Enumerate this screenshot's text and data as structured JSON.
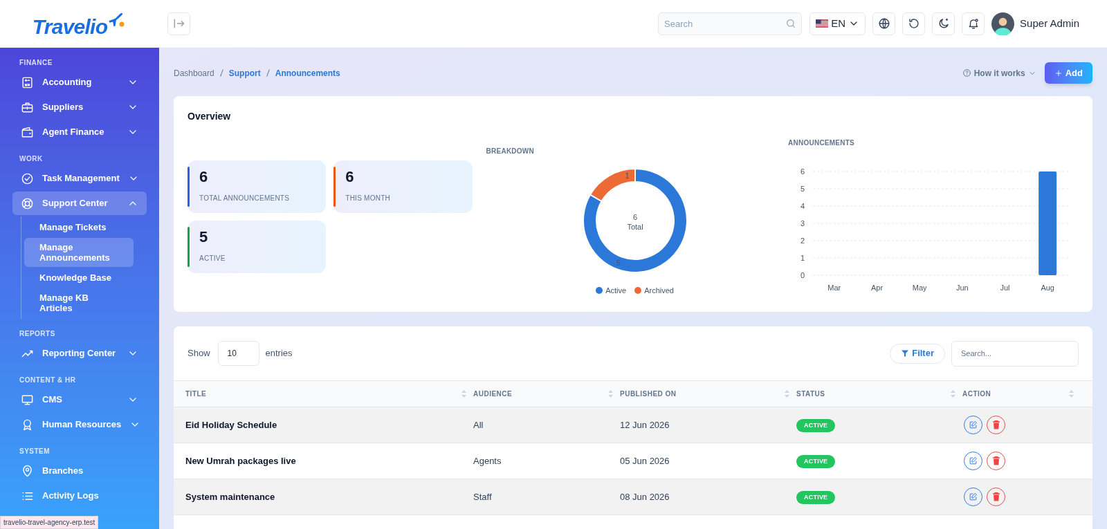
{
  "header": {
    "logo": "Travelio",
    "search": {
      "placeholder": "Search"
    },
    "language": "EN",
    "user": "Super Admin"
  },
  "sidebar": {
    "sections": [
      {
        "title": "FINANCE",
        "items": [
          {
            "label": "Accounting",
            "kind": "group",
            "expanded": false,
            "selected": false
          },
          {
            "label": "Suppliers",
            "kind": "group",
            "expanded": false,
            "selected": false
          },
          {
            "label": "Agent Finance",
            "kind": "group",
            "expanded": false,
            "selected": false
          }
        ]
      },
      {
        "title": "WORK",
        "items": [
          {
            "label": "Task Management",
            "kind": "group",
            "expanded": false,
            "selected": false
          },
          {
            "label": "Support Center",
            "kind": "group",
            "expanded": true,
            "selected": true,
            "children": [
              {
                "label": "Manage Tickets",
                "selected": false
              },
              {
                "label": "Manage Announcements",
                "selected": true
              },
              {
                "label": "Knowledge Base",
                "selected": false
              },
              {
                "label": "Manage KB Articles",
                "selected": false
              }
            ]
          }
        ]
      },
      {
        "title": "REPORTS",
        "items": [
          {
            "label": "Reporting Center",
            "kind": "group",
            "expanded": false,
            "selected": false
          }
        ]
      },
      {
        "title": "CONTENT & HR",
        "items": [
          {
            "label": "CMS",
            "kind": "group",
            "expanded": false,
            "selected": false
          },
          {
            "label": "Human Resources",
            "kind": "group",
            "expanded": false,
            "selected": false
          }
        ]
      },
      {
        "title": "SYSTEM",
        "items": [
          {
            "label": "Branches",
            "kind": "link",
            "selected": false
          },
          {
            "label": "Activity Logs",
            "kind": "link",
            "selected": false
          }
        ]
      }
    ]
  },
  "breadcrumb": [
    "Dashboard",
    "Support",
    "Announcements"
  ],
  "how_it_works": "How it works",
  "add_button": "Add",
  "overview": {
    "title": "Overview",
    "stats": [
      {
        "value": "6",
        "label": "TOTAL ANNOUNCEMENTS",
        "color": "#2563eb"
      },
      {
        "value": "6",
        "label": "THIS MONTH",
        "color": "#ea580c"
      },
      {
        "value": "5",
        "label": "ACTIVE",
        "color": "#16a34a"
      }
    ],
    "breakdown": {
      "title": "BREAKDOWN",
      "center_value": "6",
      "center_label": "Total",
      "chart_data": {
        "type": "donut",
        "categories": [
          "Active",
          "Archived"
        ],
        "series": [
          {
            "values": [
              5,
              1
            ]
          }
        ],
        "colors": [
          "#2b78d8",
          "#eb6a35"
        ],
        "data_labels": true
      }
    },
    "announcements": {
      "title": "ANNOUNCEMENTS",
      "chart_data": {
        "type": "bar",
        "categories": [
          "Mar",
          "Apr",
          "May",
          "Jun",
          "Jul",
          "Aug"
        ],
        "series": [
          {
            "color": "#2b78d8",
            "values": [
              0,
              0,
              0,
              0,
              0,
              6
            ]
          }
        ],
        "ylim": [
          0,
          6
        ],
        "yticks": [
          0,
          1,
          2,
          3,
          4,
          5,
          6
        ],
        "grid": true
      }
    }
  },
  "table": {
    "show_label": "Show",
    "page_size": "10",
    "entries_label": "entries",
    "filter": "Filter",
    "search": {
      "placeholder": "Search..."
    },
    "columns": [
      "TITLE",
      "AUDIENCE",
      "PUBLISHED ON",
      "STATUS",
      "ACTION"
    ],
    "rows": [
      {
        "title": "Eid Holiday Schedule",
        "audience": "All",
        "published_on": "12 Jun 2026",
        "status": "ACTIVE"
      },
      {
        "title": "New Umrah packages live",
        "audience": "Agents",
        "published_on": "05 Jun 2026",
        "status": "ACTIVE"
      },
      {
        "title": "System maintenance",
        "audience": "Staff",
        "published_on": "08 Jun 2026",
        "status": "ACTIVE"
      }
    ]
  },
  "status_url": "travelio-travel-agency-erp.test"
}
